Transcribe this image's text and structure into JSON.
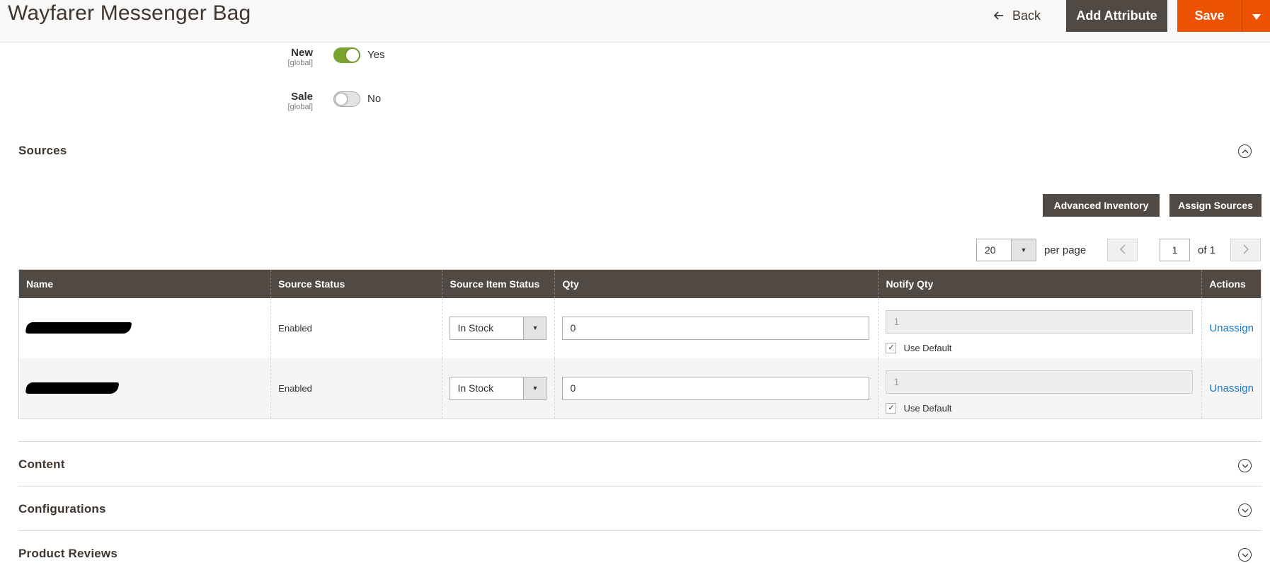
{
  "header": {
    "title": "Wayfarer Messenger Bag",
    "back_label": "Back",
    "add_attribute_label": "Add Attribute",
    "save_label": "Save"
  },
  "attributes": [
    {
      "label": "New",
      "scope": "[global]",
      "enabled": true,
      "value_text": "Yes"
    },
    {
      "label": "Sale",
      "scope": "[global]",
      "enabled": false,
      "value_text": "No"
    }
  ],
  "sources": {
    "title": "Sources",
    "advanced_inventory_label": "Advanced Inventory",
    "assign_sources_label": "Assign Sources",
    "pager": {
      "per_page_value": "20",
      "per_page_label": "per page",
      "current_page": "1",
      "of_label": "of 1"
    },
    "columns": [
      "Name",
      "Source Status",
      "Source Item Status",
      "Qty",
      "Notify Qty",
      "Actions"
    ],
    "rows": [
      {
        "name": "",
        "source_status": "Enabled",
        "item_status": "In Stock",
        "qty": "0",
        "notify_qty": "1",
        "use_default_label": "Use Default",
        "use_default_checked": true,
        "action": "Unassign"
      },
      {
        "name": "",
        "source_status": "Enabled",
        "item_status": "In Stock",
        "qty": "0",
        "notify_qty": "1",
        "use_default_label": "Use Default",
        "use_default_checked": true,
        "action": "Unassign"
      }
    ]
  },
  "sections": [
    {
      "title": "Content"
    },
    {
      "title": "Configurations"
    },
    {
      "title": "Product Reviews"
    }
  ],
  "colors": {
    "brand_dark": "#514943",
    "save_orange": "#eb5202",
    "toggle_on": "#79a22e",
    "link_blue": "#1979c3"
  }
}
